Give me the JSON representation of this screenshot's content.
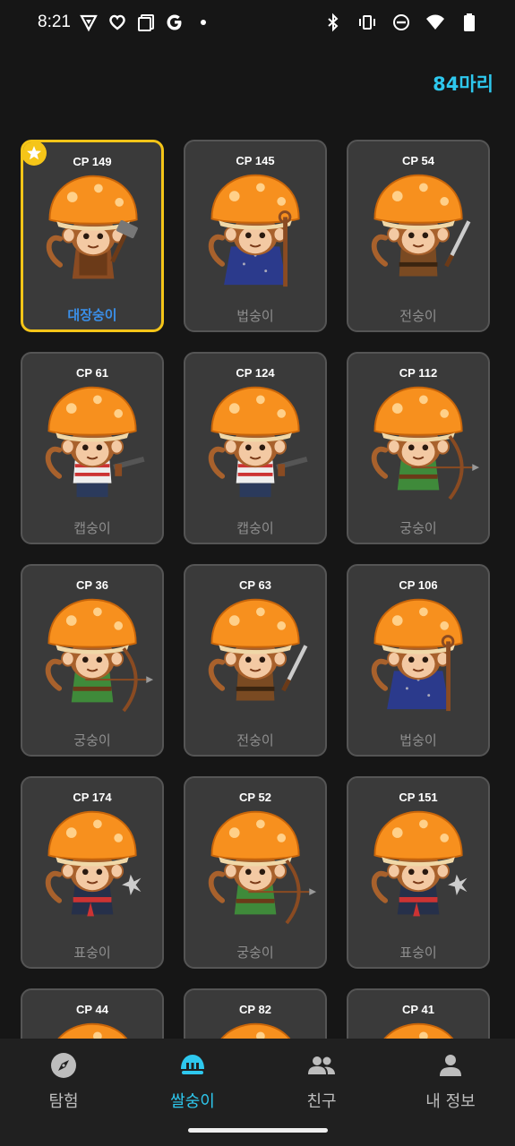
{
  "status": {
    "time": "8:21",
    "left_icons": [
      "vpn-shield-icon",
      "heart-app-icon",
      "copy-icon",
      "google-g-icon",
      "dot-icon"
    ],
    "right_icons": [
      "bluetooth-icon",
      "vibrate-icon",
      "do-not-disturb-icon",
      "wifi-icon",
      "battery-icon"
    ]
  },
  "header": {
    "count": "84마리"
  },
  "cards": [
    {
      "cp": "CP 149",
      "name": "대장숭이",
      "class": "blacksmith",
      "selected": true
    },
    {
      "cp": "CP 145",
      "name": "법숭이",
      "class": "mage"
    },
    {
      "cp": "CP 54",
      "name": "전숭이",
      "class": "warrior"
    },
    {
      "cp": "CP 61",
      "name": "캡숭이",
      "class": "pirate"
    },
    {
      "cp": "CP 124",
      "name": "캡숭이",
      "class": "pirate"
    },
    {
      "cp": "CP 112",
      "name": "궁숭이",
      "class": "archer"
    },
    {
      "cp": "CP 36",
      "name": "궁숭이",
      "class": "archer"
    },
    {
      "cp": "CP 63",
      "name": "전숭이",
      "class": "warrior"
    },
    {
      "cp": "CP 106",
      "name": "법숭이",
      "class": "mage"
    },
    {
      "cp": "CP 174",
      "name": "표숭이",
      "class": "ninja"
    },
    {
      "cp": "CP 52",
      "name": "궁숭이",
      "class": "archer"
    },
    {
      "cp": "CP 151",
      "name": "표숭이",
      "class": "ninja"
    },
    {
      "cp": "CP 44",
      "name": "",
      "class": "unknown"
    },
    {
      "cp": "CP 82",
      "name": "",
      "class": "unknown"
    },
    {
      "cp": "CP 41",
      "name": "",
      "class": "unknown"
    }
  ],
  "nav": {
    "explore": "탐험",
    "monkeys": "쌀숭이",
    "friends": "친구",
    "my_info": "내 정보"
  },
  "colors": {
    "accent": "#2ec8ee",
    "selected_border": "#f5c518",
    "selected_name": "#3a8fe8",
    "card_bg": "#3a3a3a",
    "background": "#161616"
  }
}
